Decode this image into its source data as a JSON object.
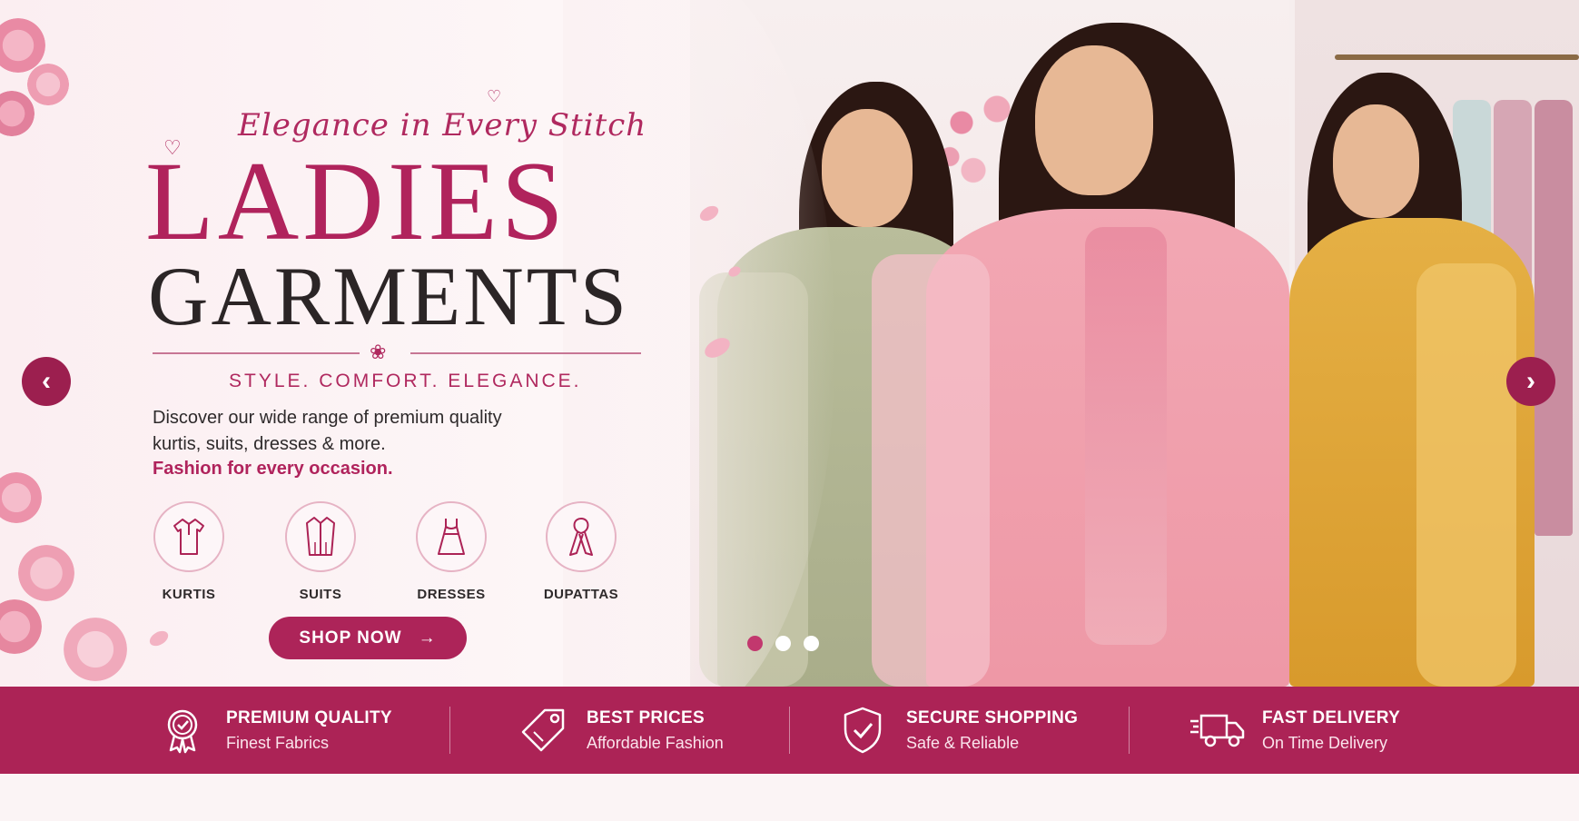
{
  "banner": {
    "tagline": "Elegance in Every Stitch",
    "title_line1": "LADIES",
    "title_line2": "GARMENTS",
    "slogan": "STYLE. COMFORT. ELEGANCE.",
    "description": "Discover our wide range of premium quality kurtis, suits, dresses & more.",
    "description_emphasis": "Fashion for every occasion.",
    "categories": [
      {
        "label": "KURTIS",
        "icon": "kurti-icon"
      },
      {
        "label": "SUITS",
        "icon": "suit-icon"
      },
      {
        "label": "DRESSES",
        "icon": "dress-icon"
      },
      {
        "label": "DUPATTAS",
        "icon": "dupatta-icon"
      }
    ],
    "cta_label": "SHOP NOW",
    "slider": {
      "total": 3,
      "active_index": 0
    }
  },
  "features": [
    {
      "title": "PREMIUM QUALITY",
      "subtitle": "Finest Fabrics",
      "icon": "award-badge-icon"
    },
    {
      "title": "BEST PRICES",
      "subtitle": "Affordable Fashion",
      "icon": "price-tag-icon"
    },
    {
      "title": "SECURE SHOPPING",
      "subtitle": "Safe & Reliable",
      "icon": "shield-check-icon"
    },
    {
      "title": "FAST DELIVERY",
      "subtitle": "On Time Delivery",
      "icon": "delivery-truck-icon"
    }
  ],
  "colors": {
    "brand": "#ac2356",
    "accent_dark": "#2b2526",
    "background": "#fbf4f5"
  }
}
